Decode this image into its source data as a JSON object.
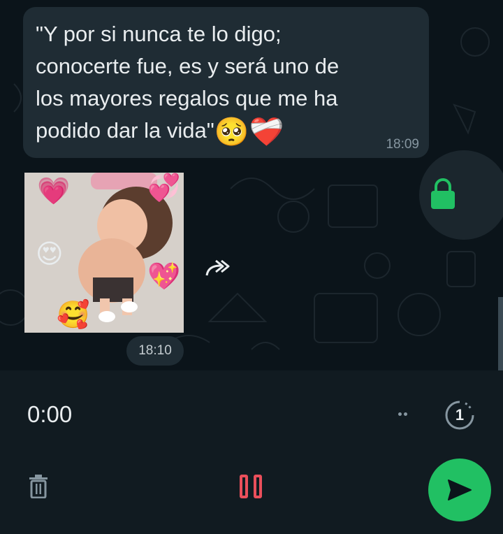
{
  "chat": {
    "message": {
      "text": "\"Y por si nunca te lo digo;\nconocerte fue, es y será uno de\nlos mayores regalos que me ha\npodido dar la vida\"",
      "emojis": [
        "🥺",
        "❤️‍🩹"
      ],
      "time": "18:09"
    },
    "photo": {
      "time": "18:10",
      "stickers": [
        "💗",
        "💞",
        "😍",
        "💖",
        "🥰"
      ]
    },
    "icons": {
      "forward": "forward-icon",
      "lock": "lock-icon"
    }
  },
  "recorder": {
    "timer": "0:00",
    "view_once_label": "1",
    "icons": {
      "delete": "trash-icon",
      "pause": "pause-icon",
      "send": "send-icon",
      "view_once": "view-once-icon"
    }
  },
  "colors": {
    "background": "#0b141a",
    "bubble": "#1f2c34",
    "accent_green": "#21c063",
    "pause_red": "#ea4f5b",
    "secondary_text": "#8696a0"
  }
}
